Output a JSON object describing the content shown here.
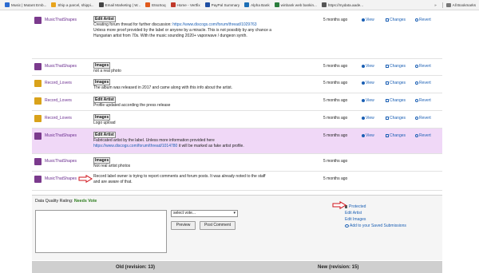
{
  "bookmarks": {
    "items": [
      {
        "label": "Music | Mutant Emb...",
        "color": "#2b6bd1"
      },
      {
        "label": "Ship a parcel, shippi...",
        "color": "#e8a41c"
      },
      {
        "label": "Email Marketing | W...",
        "color": "#444444"
      },
      {
        "label": "EtsoSoq",
        "color": "#e05a1c"
      },
      {
        "label": "Home - Vertfix",
        "color": "#c0392b"
      },
      {
        "label": "PayPal Summary",
        "color": "#1f4fa3"
      },
      {
        "label": "Alpha Bank",
        "color": "#1d6fb5"
      },
      {
        "label": "winbank web bankin...",
        "color": "#2a7d3c"
      },
      {
        "label": "https://mydata.aade...",
        "color": "#555555"
      }
    ],
    "all_label": "All Bookmarks"
  },
  "actions": {
    "view": "View",
    "changes": "Changes",
    "revert": "Revert"
  },
  "rows": [
    {
      "user": "MusicThatShapes",
      "avatar_color": "#7b3a8d",
      "label": "Edit Artist",
      "lines": [
        "Creating forum thread for further discussion: "
      ],
      "link": "https://www.discogs.com/forum/thread/1029763",
      "more": [
        "",
        "Unless more proof provided by the label or anyone by a miracle. This is not possibly by any chance a",
        "Hungarian artist from 70s. With the music sounding 2020+ vaporwave / dungeon synth."
      ],
      "time": "5 months ago"
    },
    {
      "user": "MusicThatShapes",
      "avatar_color": "#7b3a8d",
      "label": "Images",
      "lines": [
        "not a real photo"
      ],
      "time": "5 months ago"
    },
    {
      "user": "Record_Lovers",
      "avatar_color": "#d9a21a",
      "label": "Images",
      "lines": [
        "The album was released in 2017 and came along with this info about the artist."
      ],
      "time": "5 months ago"
    },
    {
      "user": "Record_Lovers",
      "avatar_color": "#d9a21a",
      "label": "Edit Artist",
      "lines": [
        "Profile updated according the press release"
      ],
      "time": "5 months ago"
    },
    {
      "user": "Record_Lovers",
      "avatar_color": "#d9a21a",
      "label": "Images",
      "lines": [
        "Logo upload"
      ],
      "time": "5 months ago"
    },
    {
      "user": "MusicThatShapes",
      "avatar_color": "#7b3a8d",
      "label": "Edit Artist",
      "lines": [
        "Fabricated artist by the label. Unless more information provided here"
      ],
      "link": "https://www.discogs.com/forum/thread/1014780",
      "link_suffix": " it will be marked as fake artist profile.",
      "time": "5 months ago",
      "highlight": true
    },
    {
      "user": "MusicThatShapes",
      "avatar_color": "#7b3a8d",
      "label": "Images",
      "lines": [
        "Not real artist photos"
      ],
      "time": "5 months ago"
    },
    {
      "user": "MusicThatShapes",
      "avatar_color": "#7b3a8d",
      "lines": [
        "Record label owner is trying to report comments and forum posts. It was already noted to the staff",
        "and are aware of that."
      ],
      "time": "5 months ago"
    }
  ],
  "data_quality": {
    "label": "Data Quality Rating:",
    "value": "Needs Vote",
    "value_color": "#2e7d1f",
    "select_value": "select vote...",
    "preview_label": "Preview",
    "post_label": "Post Comment",
    "links": {
      "protected": "Protected",
      "edit_artist": "Edit Artist",
      "edit_images": "Edit Images",
      "add_saved": "Add to your Saved Submissions"
    }
  },
  "revisions": {
    "old": "Old (revision: 13)",
    "new": "New (revision: 15)"
  }
}
